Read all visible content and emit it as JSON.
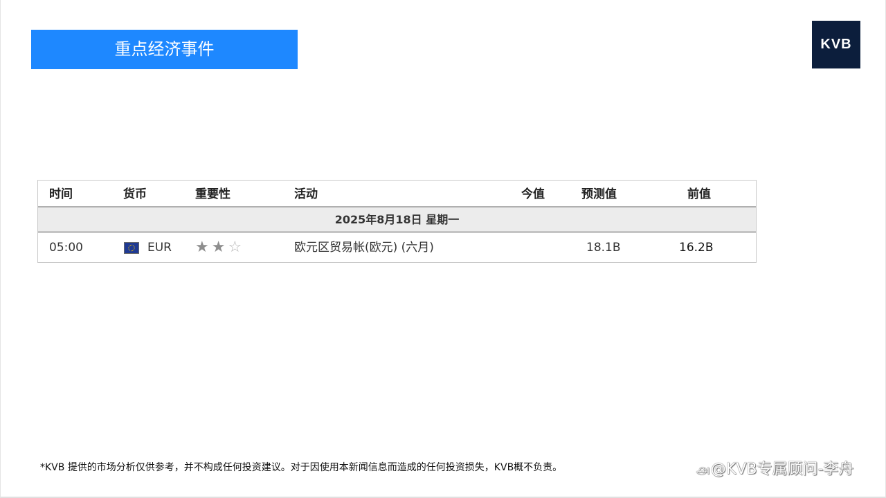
{
  "header": {
    "title": "重点经济事件",
    "logo_text": "KVB"
  },
  "table": {
    "columns": [
      "时间",
      "货币",
      "重要性",
      "活动",
      "今值",
      "预测值",
      "前值"
    ],
    "date_group": "2025年8月18日  星期一",
    "rows": [
      {
        "time": "05:00",
        "currency": "EUR",
        "flag_icon": "eu-flag-icon",
        "importance_stars": 2,
        "importance_max": 3,
        "event": "欧元区贸易帐(欧元) (六月)",
        "actual": "",
        "forecast": "18.1B",
        "previous": "16.2B"
      }
    ]
  },
  "footer": {
    "disclaimer": "*KVB 提供的市场分析仅供参考，并不构成任何投资建议。对于因使用本新闻信息而造成的任何投资损失，KVB概不负责。",
    "watermark": "@KVB专属顾问-李舟"
  },
  "colors": {
    "banner": "#1e88ff",
    "logo_bg": "#0c1e3c",
    "date_row_bg": "#ececec",
    "star_filled": "#8e8e8e"
  }
}
